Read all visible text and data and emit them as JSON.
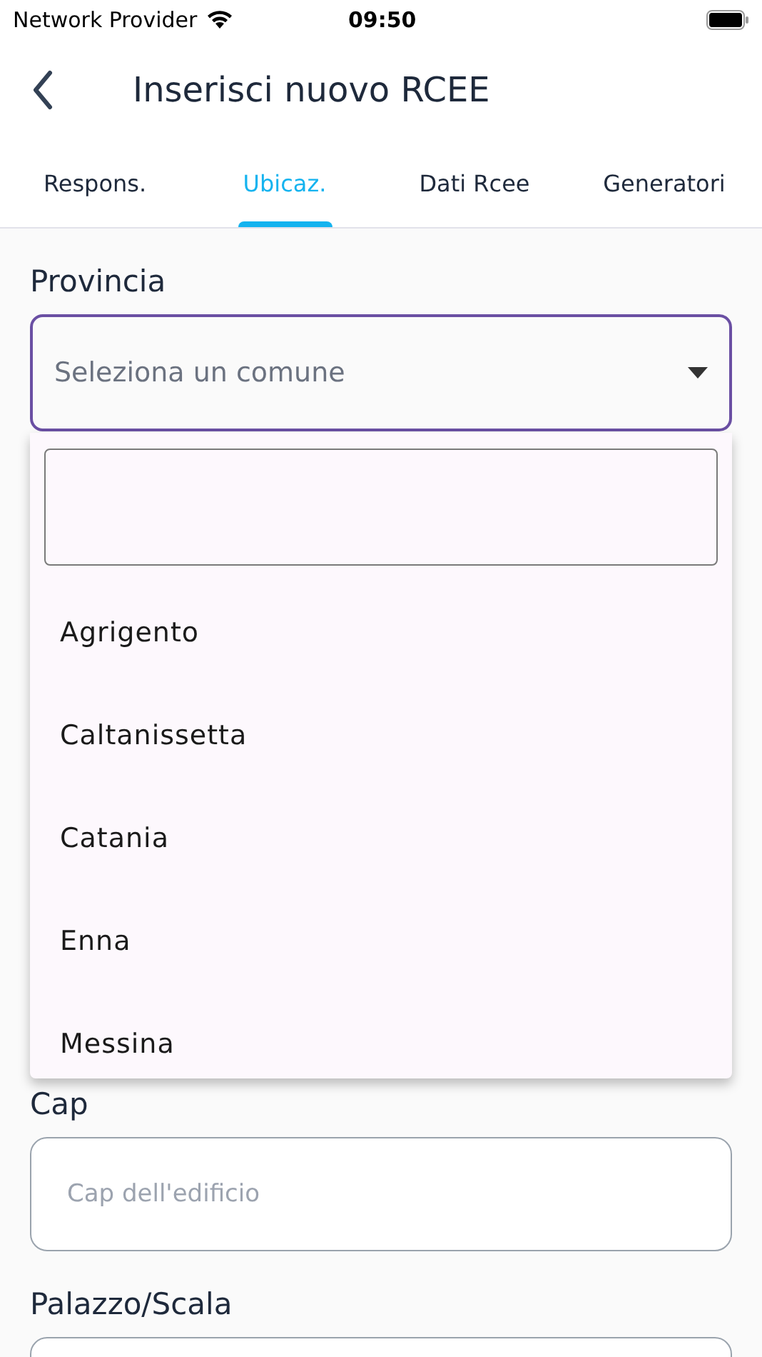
{
  "status_bar": {
    "carrier": "Network Provider",
    "time": "09:50"
  },
  "header": {
    "title": "Inserisci nuovo RCEE"
  },
  "tabs": [
    {
      "label": "Respons.",
      "selected": false
    },
    {
      "label": "Ubicaz.",
      "selected": true
    },
    {
      "label": "Dati Rcee",
      "selected": false
    },
    {
      "label": "Generatori",
      "selected": false
    }
  ],
  "provincia": {
    "label": "Provincia",
    "placeholder": "Seleziona un comune",
    "expanded": true,
    "options": [
      "Agrigento",
      "Caltanissetta",
      "Catania",
      "Enna",
      "Messina"
    ]
  },
  "fields": [
    {
      "label": "Cap",
      "placeholder": "Cap dell'edificio"
    },
    {
      "label": "Palazzo/Scala"
    }
  ]
}
